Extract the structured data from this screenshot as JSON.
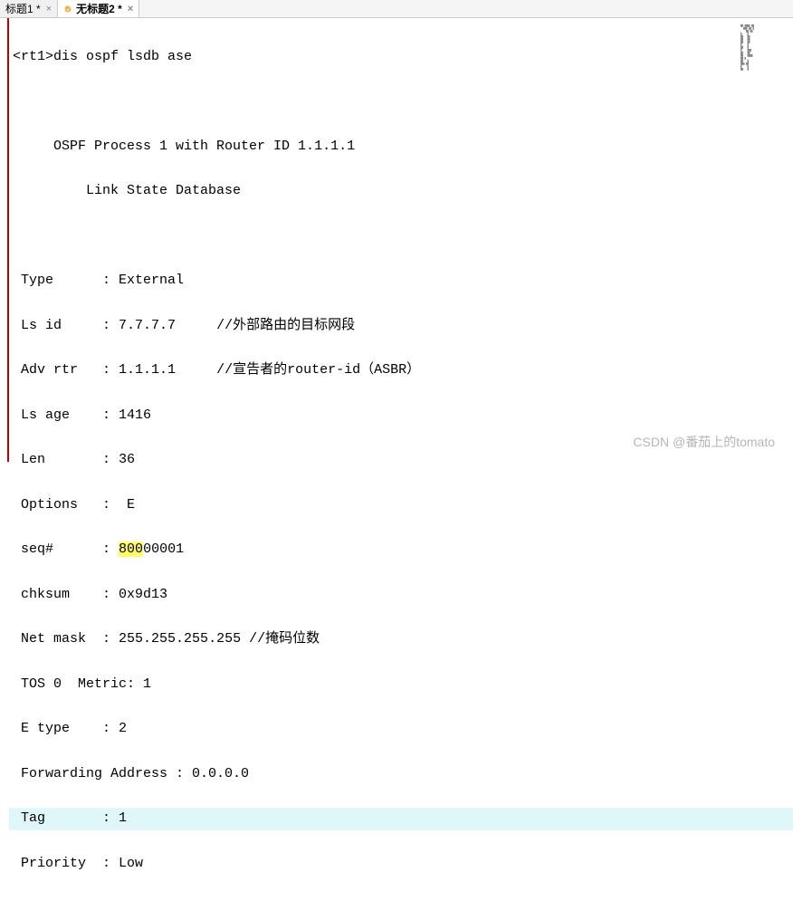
{
  "tabs": [
    {
      "label": "标题1 *",
      "active": false
    },
    {
      "label": "无标题2 *",
      "active": true
    }
  ],
  "terminal": {
    "prompt": "<rt1>",
    "command": "dis ospf lsdb ase",
    "header1": "OSPF Process 1 with Router ID 1.1.1.1",
    "header2": "Link State Database",
    "fields": {
      "type_label": "Type",
      "type_value": "External",
      "lsid_label": "Ls id",
      "lsid_value": "7.7.7.7",
      "lsid_comment": "//外部路由的目标网段",
      "advrtr_label": "Adv rtr",
      "advrtr_value": "1.1.1.1",
      "advrtr_comment": "//宣告者的router-id（ASBR）",
      "lsage_label": "Ls age",
      "lsage_value": "1416",
      "len_label": "Len",
      "len_value": "36",
      "options_label": "Options",
      "options_value": "E",
      "seq_label": "seq#",
      "seq_hl": "800",
      "seq_rest": "00001",
      "chksum_label": "chksum",
      "chksum_value": "0x9d13",
      "netmask_label": "Net mask",
      "netmask_value": "255.255.255.255",
      "netmask_comment": "//掩码位数",
      "tos_line": "TOS 0  Metric: 1",
      "etype_label": "E type",
      "etype_value": "2",
      "fwd_line": "Forwarding Address : 0.0.0.0",
      "tag_label": "Tag",
      "tag_value": "1",
      "priority_label": "Priority",
      "priority_value": "Low"
    }
  },
  "watermark": "CSDN @番茄上的tomato"
}
